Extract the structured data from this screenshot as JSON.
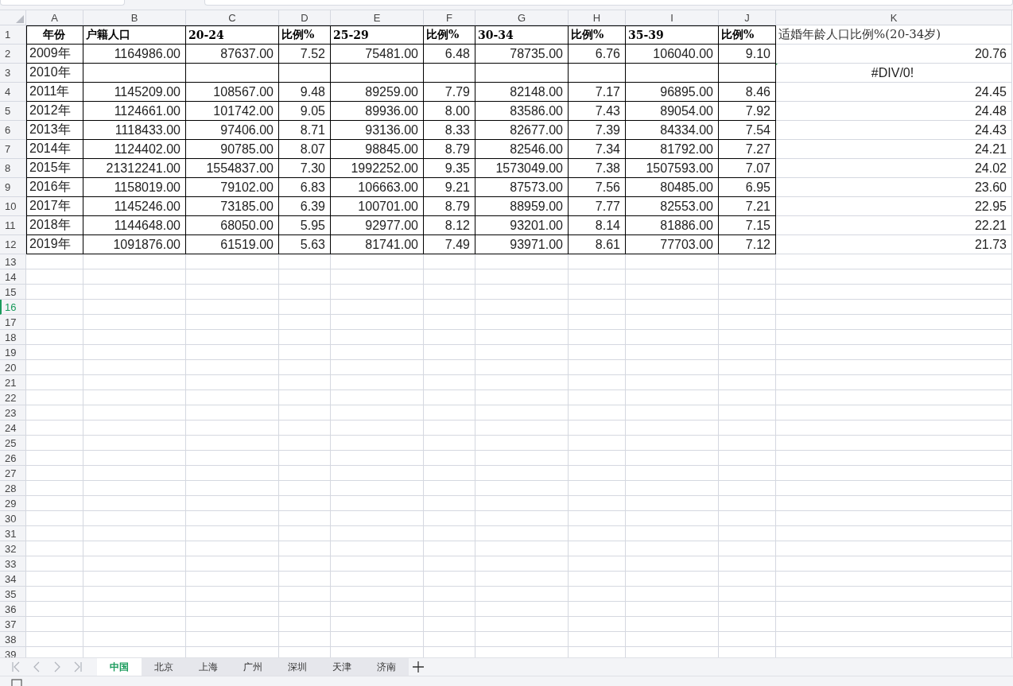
{
  "columns": [
    "A",
    "B",
    "C",
    "D",
    "E",
    "F",
    "G",
    "H",
    "I",
    "J",
    "K"
  ],
  "rows": [
    {
      "number": "1",
      "selected": false,
      "kind": "header",
      "cells": [
        "年份",
        "户籍人口",
        "20-24",
        "比例%",
        "25-29",
        "比例%",
        "30-34",
        "比例%",
        "35-39",
        "比例%",
        "适婚年龄人口比例%(20-34岁)"
      ]
    },
    {
      "number": "2",
      "selected": false,
      "kind": "data",
      "cells": [
        "2009年",
        "1164986.00",
        "87637.00",
        "7.52",
        "75481.00",
        "6.48",
        "78735.00",
        "6.76",
        "106040.00",
        "9.10",
        "20.76"
      ]
    },
    {
      "number": "3",
      "selected": false,
      "kind": "data",
      "cells": [
        "2010年",
        null,
        null,
        null,
        null,
        null,
        null,
        null,
        null,
        null,
        {
          "text": "#DIV/0!",
          "kind": "error"
        }
      ]
    },
    {
      "number": "4",
      "selected": false,
      "kind": "data",
      "cells": [
        "2011年",
        "1145209.00",
        "108567.00",
        "9.48",
        "89259.00",
        "7.79",
        "82148.00",
        "7.17",
        "96895.00",
        "8.46",
        "24.45"
      ]
    },
    {
      "number": "5",
      "selected": false,
      "kind": "data",
      "cells": [
        "2012年",
        "1124661.00",
        "101742.00",
        "9.05",
        "89936.00",
        "8.00",
        "83586.00",
        "7.43",
        "89054.00",
        "7.92",
        "24.48"
      ]
    },
    {
      "number": "6",
      "selected": false,
      "kind": "data",
      "cells": [
        "2013年",
        "1118433.00",
        "97406.00",
        "8.71",
        "93136.00",
        "8.33",
        "82677.00",
        "7.39",
        "84334.00",
        "7.54",
        "24.43"
      ]
    },
    {
      "number": "7",
      "selected": false,
      "kind": "data",
      "cells": [
        "2014年",
        "1124402.00",
        "90785.00",
        "8.07",
        "98845.00",
        "8.79",
        "82546.00",
        "7.34",
        "81792.00",
        "7.27",
        "24.21"
      ]
    },
    {
      "number": "8",
      "selected": false,
      "kind": "data",
      "cells": [
        "2015年",
        "21312241.00",
        "1554837.00",
        "7.30",
        "1992252.00",
        "9.35",
        "1573049.00",
        "7.38",
        "1507593.00",
        "7.07",
        "24.02"
      ]
    },
    {
      "number": "9",
      "selected": false,
      "kind": "data",
      "cells": [
        "2016年",
        "1158019.00",
        "79102.00",
        "6.83",
        "106663.00",
        "9.21",
        "87573.00",
        "7.56",
        "80485.00",
        "6.95",
        "23.60"
      ]
    },
    {
      "number": "10",
      "selected": false,
      "kind": "data",
      "cells": [
        "2017年",
        "1145246.00",
        "73185.00",
        "6.39",
        "100701.00",
        "8.79",
        "88959.00",
        "7.77",
        "82553.00",
        "7.21",
        "22.95"
      ]
    },
    {
      "number": "11",
      "selected": false,
      "kind": "data",
      "cells": [
        "2018年",
        "1144648.00",
        "68050.00",
        "5.95",
        "92977.00",
        "8.12",
        "93201.00",
        "8.14",
        "81886.00",
        "7.15",
        "22.21"
      ]
    },
    {
      "number": "12",
      "selected": false,
      "kind": "data",
      "cells": [
        "2019年",
        "1091876.00",
        "61519.00",
        "5.63",
        "81741.00",
        "7.49",
        "93971.00",
        "8.61",
        "77703.00",
        "7.12",
        "21.73"
      ]
    },
    {
      "number": "13",
      "selected": false
    },
    {
      "number": "14",
      "selected": false
    },
    {
      "number": "15",
      "selected": false
    },
    {
      "number": "16",
      "selected": true
    },
    {
      "number": "17",
      "selected": false
    },
    {
      "number": "18",
      "selected": false
    },
    {
      "number": "19",
      "selected": false
    },
    {
      "number": "20",
      "selected": false
    },
    {
      "number": "21",
      "selected": false
    },
    {
      "number": "22",
      "selected": false
    },
    {
      "number": "23",
      "selected": false
    },
    {
      "number": "24",
      "selected": false
    },
    {
      "number": "25",
      "selected": false
    },
    {
      "number": "26",
      "selected": false
    },
    {
      "number": "27",
      "selected": false
    },
    {
      "number": "28",
      "selected": false
    },
    {
      "number": "29",
      "selected": false
    },
    {
      "number": "30",
      "selected": false
    },
    {
      "number": "31",
      "selected": false
    },
    {
      "number": "32",
      "selected": false
    },
    {
      "number": "33",
      "selected": false
    },
    {
      "number": "34",
      "selected": false
    },
    {
      "number": "35",
      "selected": false
    },
    {
      "number": "36",
      "selected": false
    },
    {
      "number": "37",
      "selected": false
    },
    {
      "number": "38",
      "selected": false
    },
    {
      "number": "39",
      "selected": false
    }
  ],
  "sheet_tabs": [
    {
      "label": "中国",
      "selected": true
    },
    {
      "label": "北京",
      "selected": false
    },
    {
      "label": "上海",
      "selected": false
    },
    {
      "label": "广州",
      "selected": false
    },
    {
      "label": "深圳",
      "selected": false
    },
    {
      "label": "天津",
      "selected": false
    },
    {
      "label": "济南",
      "selected": false
    }
  ]
}
